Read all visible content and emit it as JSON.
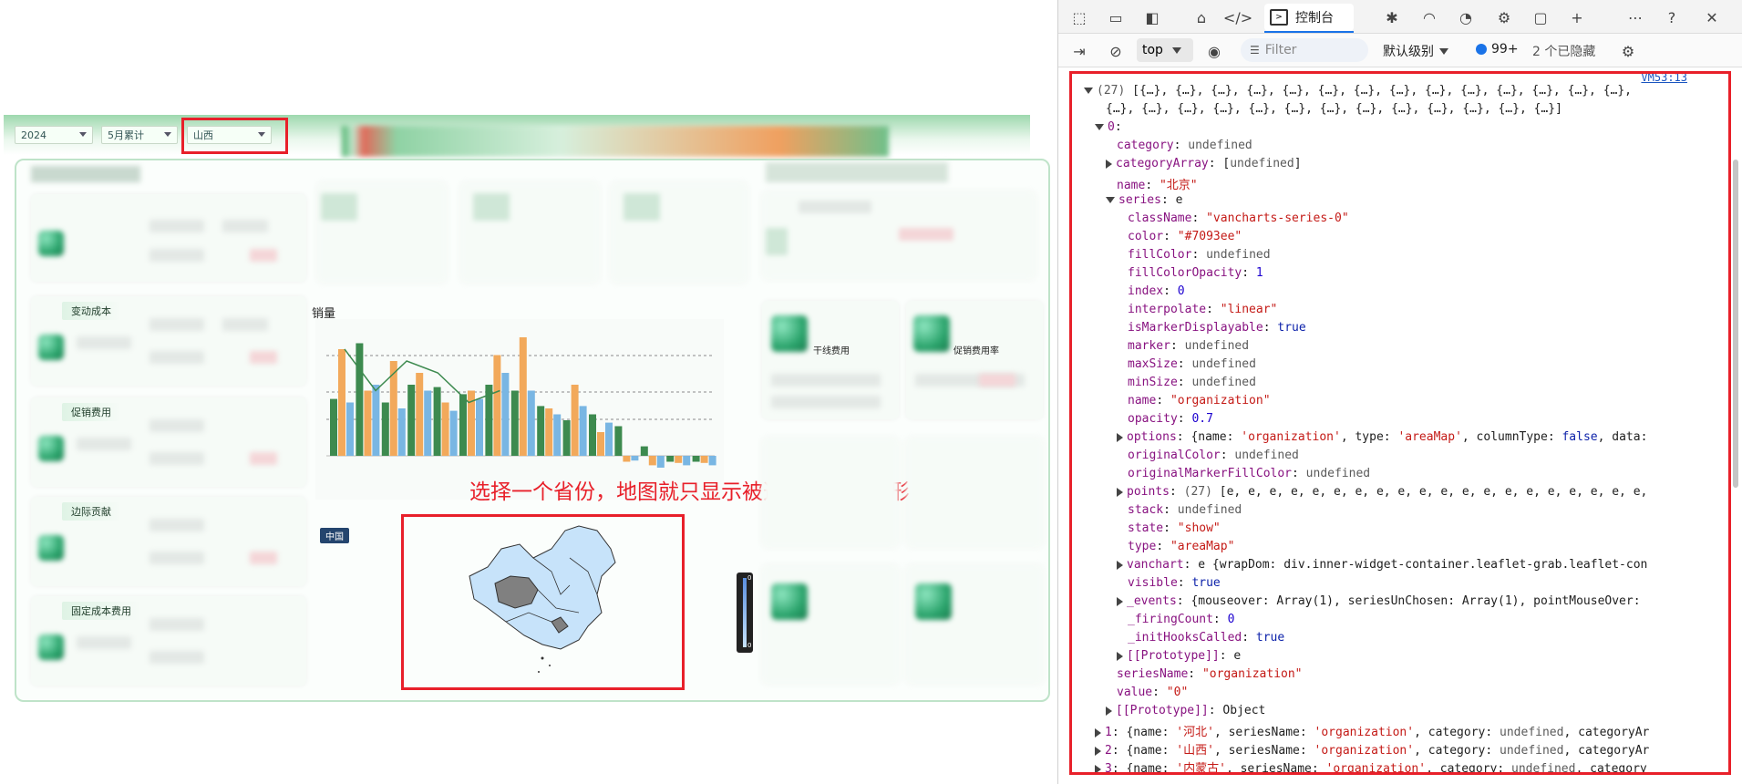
{
  "dashboard": {
    "filters": {
      "year": "2024",
      "month": "5月累计",
      "province": "山西"
    },
    "cards": {
      "variable_cost": "变动成本",
      "promo_cost": "促销费用",
      "margin": "边际贡献",
      "fixed_cost": "固定成本费用"
    },
    "sales_label": "销量",
    "right_cards": {
      "trunk": "干线费用",
      "promo_rate": "促销费用率"
    },
    "map_tag": "中国",
    "annotation": "选择一个省份，地图就只显示被选择省份的图形",
    "legend_max": "0",
    "legend_min": "0",
    "chart_data": {
      "type": "bar",
      "title": "",
      "categories": [
        "",
        "",
        "",
        "",
        "",
        "",
        "",
        "",
        "",
        "",
        "",
        "",
        "",
        "",
        ""
      ],
      "series": [
        {
          "name": "",
          "values": [
            48,
            95,
            45,
            60,
            58,
            52,
            60,
            55,
            42,
            30,
            35,
            25,
            8,
            -5,
            -5
          ],
          "color": "#3d8a4f"
        },
        {
          "name": "",
          "values": [
            90,
            55,
            80,
            70,
            45,
            55,
            85,
            100,
            40,
            60,
            20,
            -5,
            -8,
            -6,
            -6
          ],
          "color": "#f2a95b"
        },
        {
          "name": "",
          "values": [
            45,
            60,
            40,
            55,
            38,
            48,
            70,
            55,
            35,
            42,
            28,
            -4,
            -10,
            -8,
            -8
          ],
          "color": "#79b6e3"
        }
      ]
    }
  },
  "devtools": {
    "tabs": {
      "console": "控制台"
    },
    "toolbar2": {
      "context": "top",
      "filter_placeholder": "Filter",
      "level": "默认级别",
      "issues": "99+",
      "hidden": "2 个已隐藏"
    },
    "source_link": "VM53:13",
    "lines": [
      {
        "indent": 0,
        "tri": "down",
        "html": "<span class='u'>(27)</span> [{…}, {…}, {…}, {…}, {…}, {…}, {…}, {…}, {…}, {…}, {…}, {…}, {…}, {…},"
      },
      {
        "indent": 2,
        "tri": "",
        "html": "{…}, {…}, {…}, {…}, {…}, {…}, {…}, {…}, {…}, {…}, {…}, {…}, {…}]"
      },
      {
        "indent": 1,
        "tri": "down",
        "html": "<span class='k'>0</span>:"
      },
      {
        "indent": 3,
        "tri": "",
        "html": "<span class='k'>category</span>: <span class='u'>undefined</span>"
      },
      {
        "indent": 2,
        "tri": "right",
        "html": "<span class='k'>categoryArray</span>: [<span class='u'>undefined</span>]"
      },
      {
        "indent": 3,
        "tri": "",
        "html": "<span class='k'>name</span>: <span class='s'>\"北京\"</span>"
      },
      {
        "indent": 2,
        "tri": "down",
        "html": "<span class='k'>series</span>: e"
      },
      {
        "indent": 4,
        "tri": "",
        "html": "<span class='k'>className</span>: <span class='s'>\"vancharts-series-0\"</span>"
      },
      {
        "indent": 4,
        "tri": "",
        "html": "<span class='k'>color</span>: <span class='s'>\"#7093ee\"</span>"
      },
      {
        "indent": 4,
        "tri": "",
        "html": "<span class='k'>fillColor</span>: <span class='u'>undefined</span>"
      },
      {
        "indent": 4,
        "tri": "",
        "html": "<span class='k'>fillColorOpacity</span>: <span class='n'>1</span>"
      },
      {
        "indent": 4,
        "tri": "",
        "html": "<span class='k'>index</span>: <span class='n'>0</span>"
      },
      {
        "indent": 4,
        "tri": "",
        "html": "<span class='k'>interpolate</span>: <span class='s'>\"linear\"</span>"
      },
      {
        "indent": 4,
        "tri": "",
        "html": "<span class='k'>isMarkerDisplayable</span>: <span class='b'>true</span>"
      },
      {
        "indent": 4,
        "tri": "",
        "html": "<span class='k'>marker</span>: <span class='u'>undefined</span>"
      },
      {
        "indent": 4,
        "tri": "",
        "html": "<span class='k'>maxSize</span>: <span class='u'>undefined</span>"
      },
      {
        "indent": 4,
        "tri": "",
        "html": "<span class='k'>minSize</span>: <span class='u'>undefined</span>"
      },
      {
        "indent": 4,
        "tri": "",
        "html": "<span class='k'>name</span>: <span class='s'>\"organization\"</span>"
      },
      {
        "indent": 4,
        "tri": "",
        "html": "<span class='k'>opacity</span>: <span class='n'>0.7</span>"
      },
      {
        "indent": 3,
        "tri": "right",
        "html": "<span class='k'>options</span>: {name: <span class='s'>'organization'</span>, type: <span class='s'>'areaMap'</span>, columnType: <span class='b'>false</span>, data:"
      },
      {
        "indent": 4,
        "tri": "",
        "html": "<span class='k'>originalColor</span>: <span class='u'>undefined</span>"
      },
      {
        "indent": 4,
        "tri": "",
        "html": "<span class='k'>originalMarkerFillColor</span>: <span class='u'>undefined</span>"
      },
      {
        "indent": 3,
        "tri": "right",
        "html": "<span class='k'>points</span>: <span class='u'>(27)</span> [e, e, e, e, e, e, e, e, e, e, e, e, e, e, e, e, e, e, e, e,"
      },
      {
        "indent": 4,
        "tri": "",
        "html": "<span class='k'>stack</span>: <span class='u'>undefined</span>"
      },
      {
        "indent": 4,
        "tri": "",
        "html": "<span class='k'>state</span>: <span class='s'>\"show\"</span>"
      },
      {
        "indent": 4,
        "tri": "",
        "html": "<span class='k'>type</span>: <span class='s'>\"areaMap\"</span>"
      },
      {
        "indent": 3,
        "tri": "right",
        "html": "<span class='k'>vanchart</span>: e {wrapDom: div.inner-widget-container.leaflet-grab.leaflet-con"
      },
      {
        "indent": 4,
        "tri": "",
        "html": "<span class='k'>visible</span>: <span class='b'>true</span>"
      },
      {
        "indent": 3,
        "tri": "right",
        "html": "<span class='k'>_events</span>: {mouseover: Array(1), seriesUnChosen: Array(1), pointMouseOver:"
      },
      {
        "indent": 4,
        "tri": "",
        "html": "<span class='k'>_firingCount</span>: <span class='n'>0</span>"
      },
      {
        "indent": 4,
        "tri": "",
        "html": "<span class='k'>_initHooksCalled</span>: <span class='b'>true</span>"
      },
      {
        "indent": 3,
        "tri": "right",
        "html": "<span class='k'>[[Prototype]]</span>: e"
      },
      {
        "indent": 3,
        "tri": "",
        "html": "<span class='k'>seriesName</span>: <span class='s'>\"organization\"</span>"
      },
      {
        "indent": 3,
        "tri": "",
        "html": "<span class='k'>value</span>: <span class='s'>\"0\"</span>"
      },
      {
        "indent": 2,
        "tri": "right",
        "html": "<span class='k'>[[Prototype]]</span>: Object"
      },
      {
        "indent": 1,
        "tri": "right",
        "html": "<span class='k'>1</span>: {name: <span class='s'>'河北'</span>, seriesName: <span class='s'>'organization'</span>, category: <span class='u'>undefined</span>, categoryAr"
      },
      {
        "indent": 1,
        "tri": "right",
        "html": "<span class='k'>2</span>: {name: <span class='s'>'山西'</span>, seriesName: <span class='s'>'organization'</span>, category: <span class='u'>undefined</span>, categoryAr"
      },
      {
        "indent": 1,
        "tri": "right",
        "html": "<span class='k'>3</span>: {name: <span class='s'>'内蒙古'</span>, seriesName: <span class='s'>'organization'</span>, category: <span class='u'>undefined</span>, category"
      }
    ]
  }
}
